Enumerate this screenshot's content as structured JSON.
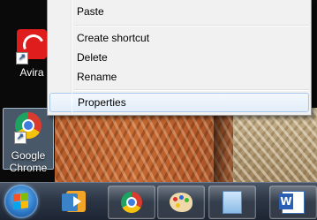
{
  "desktop": {
    "icons": [
      {
        "label": "Avira",
        "icon": "avira-icon"
      },
      {
        "label_line1": "Google",
        "label_line2": "Chrome",
        "icon": "chrome-icon"
      }
    ]
  },
  "context_menu": {
    "items": [
      {
        "label": "Paste"
      },
      {
        "label": "Create shortcut"
      },
      {
        "label": "Delete"
      },
      {
        "label": "Rename"
      },
      {
        "label": "Properties",
        "highlighted": true
      }
    ]
  },
  "taskbar": {
    "start_icon": "windows-start-icon",
    "pinned": [
      {
        "name": "media-center",
        "icon": "media-player-icon"
      },
      {
        "name": "google-chrome",
        "icon": "chrome-icon"
      },
      {
        "name": "paint",
        "icon": "paint-palette-icon"
      },
      {
        "name": "notepad",
        "icon": "notepad-icon"
      },
      {
        "name": "microsoft-word",
        "icon": "word-icon"
      }
    ]
  },
  "colors": {
    "menu_background": "#f1f1f1",
    "menu_highlight_border": "#aac8ea",
    "taskbar": "#2c3645",
    "avira_red": "#e01d1d"
  }
}
